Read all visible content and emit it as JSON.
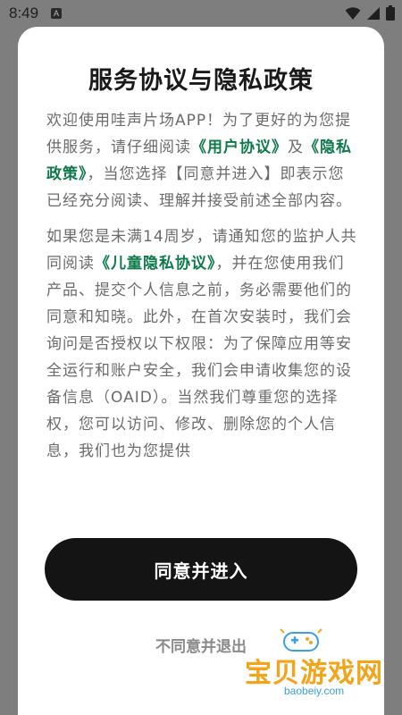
{
  "status_bar": {
    "time": "8:49",
    "notification_icon": "A",
    "icons": [
      "wifi-icon",
      "signal-icon",
      "battery-icon"
    ]
  },
  "dialog": {
    "title": "服务协议与隐私政策",
    "paragraph1": {
      "t1": "欢迎使用哇声片场APP！为了更好的为您提供服务，请仔细阅读",
      "link1": "《用户协议》",
      "t2": "及",
      "link2": "《隐私政策》",
      "t3": "，当您选择【同意并进入】即表示您已经充分阅读、理解并接受前述全部内容。"
    },
    "paragraph2": {
      "t1": "如果您是未满14周岁，请通知您的监护人共同阅读",
      "link1": "《儿童隐私协议》",
      "t2": "，并在您使用我们产品、提交个人信息之前，务必需要他们的同意和知晓。此外，在首次安装时，我们会询问是否授权以下权限：为了保障应用等安全运行和账户安全，我们会申请收集您的设备信息（OAID）。当然我们尊重您的选择权，您可以访问、修改、删除您的个人信息，我们也为您提供"
    },
    "agree_button": "同意并进入",
    "decline_link": "不同意并退出"
  },
  "watermark": {
    "text": "宝贝游戏网",
    "domain": "baobeiy.com"
  },
  "colors": {
    "link": "#0e7a4a",
    "button": "#141414",
    "overlay": "#7e7e7e"
  }
}
